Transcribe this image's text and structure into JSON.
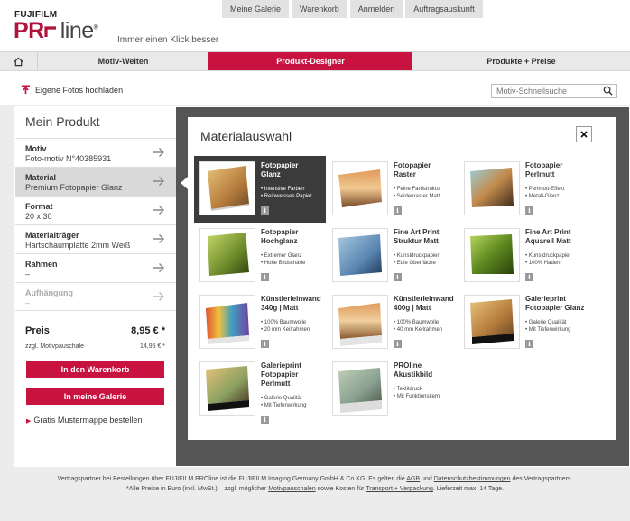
{
  "top_nav": [
    "Meine Galerie",
    "Warenkorb",
    "Anmelden",
    "Auftragsauskunft"
  ],
  "brand": {
    "maker": "FUJIFILM",
    "pr": "PR",
    "line": "line",
    "reg": "®",
    "tagline": "Immer einen Klick besser"
  },
  "main_nav": {
    "tab1": "Motiv-Welten",
    "tab2": "Produkt-Designer",
    "tab3": "Produkte + Preise"
  },
  "upload_label": "Eigene Fotos hochladen",
  "search": {
    "placeholder": "Motiv-Schnellsuche"
  },
  "product": {
    "title": "Mein Produkt",
    "rows": [
      {
        "label": "Motiv",
        "value": "Foto-motiv N°40385931"
      },
      {
        "label": "Material",
        "value": "Premium Fotopapier Glanz"
      },
      {
        "label": "Format",
        "value": "20 x 30"
      },
      {
        "label": "Materialträger",
        "value": "Hartschaumplatte 2mm Weiß"
      },
      {
        "label": "Rahmen",
        "value": "–"
      },
      {
        "label": "Aufhängung",
        "value": "–"
      }
    ],
    "price_label": "Preis",
    "price_value": "8,95 € *",
    "fee_label": "zzgl. Motivpauschale",
    "fee_value": "14,95 € *",
    "cart_button": "In den Warenkorb",
    "gallery_button": "In meine Galerie",
    "sample_link": "Gratis Mustermappe bestellen"
  },
  "popup": {
    "title": "Materialauswahl",
    "info_glyph": "i",
    "materials": [
      {
        "name": [
          "Fotopapier",
          "Glanz"
        ],
        "features": [
          "Intensive Farben",
          "Reinweisses Papier"
        ]
      },
      {
        "name": [
          "Fotopapier",
          "Raster"
        ],
        "features": [
          "Feine Farbstruktur",
          "Seidenraster Matt"
        ]
      },
      {
        "name": [
          "Fotopapier",
          "Perlmutt"
        ],
        "features": [
          "Perlmutt-Effekt",
          "Metall-Glanz"
        ]
      },
      {
        "name": [
          "Fotopapier",
          "Hochglanz"
        ],
        "features": [
          "Extremer Glanz",
          "Hohe Bildschärfe"
        ]
      },
      {
        "name": [
          "Fine Art Print",
          "Struktur Matt"
        ],
        "features": [
          "Kunstdruckpapier",
          "Edle Oberfläche"
        ]
      },
      {
        "name": [
          "Fine Art Print",
          "Aquarell Matt"
        ],
        "features": [
          "Kunstdruckpapier",
          "100% Hadern"
        ]
      },
      {
        "name": [
          "Künstlerleinwand",
          "340g | Matt"
        ],
        "features": [
          "100% Baumwolle",
          "20 mm Keilrahmen"
        ]
      },
      {
        "name": [
          "Künstlerleinwand",
          "400g | Matt"
        ],
        "features": [
          "100% Baumwolle",
          "40 mm Keilrahmen"
        ]
      },
      {
        "name": [
          "Galerieprint",
          "Fotopapier Glanz"
        ],
        "features": [
          "Galerie Qualität",
          "Mit Tiefenwirkung"
        ]
      },
      {
        "name": [
          "Galerieprint",
          "Fotopapier",
          "Perlmutt"
        ],
        "features": [
          "Galerie Qualität",
          "Mit Tiefenwirkung"
        ]
      },
      {
        "name": [
          "PROline",
          "Akustikbild"
        ],
        "features": [
          "Textildruck",
          "Mit Funktionskern"
        ]
      }
    ]
  },
  "footer": {
    "line1_a": "Vertragspartner bei Bestellungen über FUJIFILM PROline ist die FUJIFILM Imaging Germany GmbH & Co KG. Es gelten die ",
    "agb": "AGB",
    "line1_b": " und ",
    "privacy": "Datenschutzbestimmungen",
    "line1_c": " des Vertragspartners.",
    "line2_a": "*Alle Preise in Euro (inkl. MwSt.) – zzgl. möglicher ",
    "motif_fees": "Motivpauschalen",
    "line2_b": " sowie Kosten für ",
    "shipping": "Transport + Verpackung",
    "line2_c": ". Lieferzeit max. 14 Tage."
  }
}
